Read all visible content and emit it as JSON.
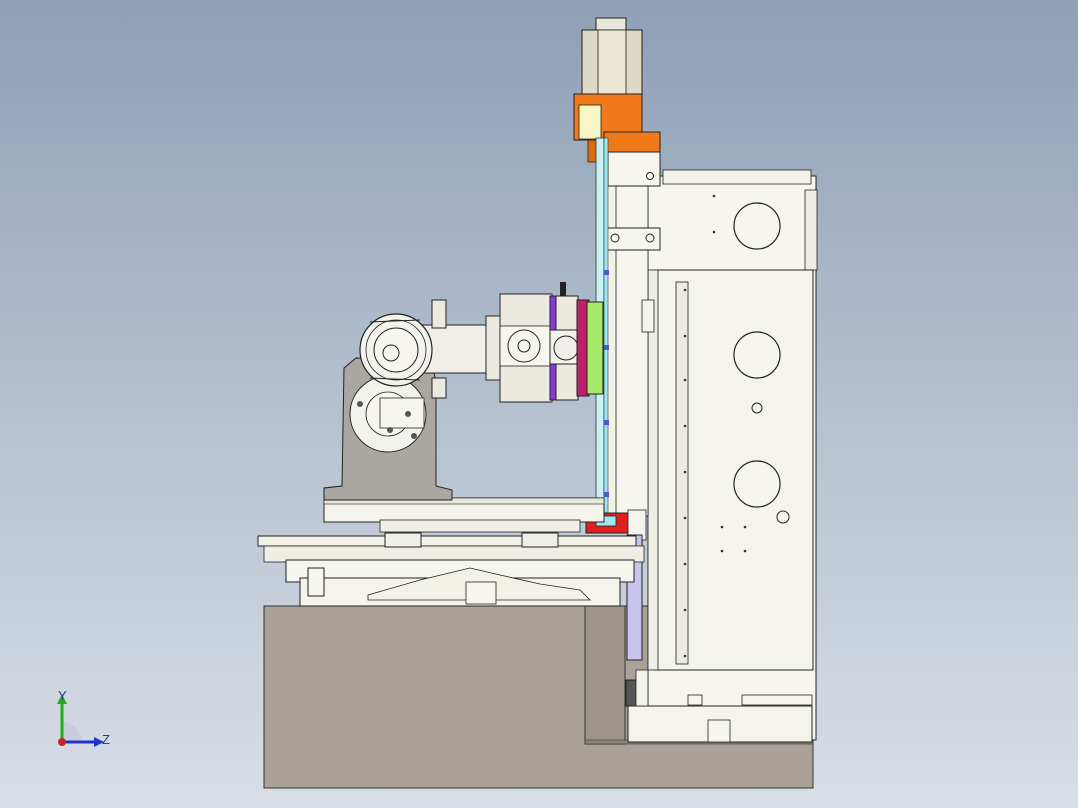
{
  "viewport": {
    "background_top": "#8f9fb5",
    "background_bottom": "#d9dee6"
  },
  "triad": {
    "y_label": "Y",
    "z_label": "Z",
    "y_color": "#22aa22",
    "z_color": "#2233cc",
    "origin_color": "#cc2222"
  },
  "colors": {
    "base": "#aaa299",
    "frame": "#f7f6ee",
    "orange": "#f07a1a",
    "purple": "#8a38d8",
    "green": "#a6e86a",
    "magenta": "#c0206a",
    "cyan": "#9fe8f0",
    "red": "#e02020",
    "lavender": "#c8c4ee",
    "gray_pedestal": "#a9a7a0"
  }
}
